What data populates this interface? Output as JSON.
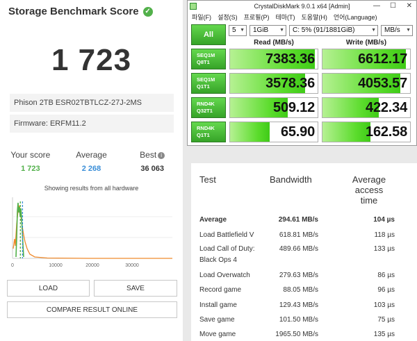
{
  "score_panel": {
    "title": "Storage Benchmark Score",
    "score": "1 723",
    "drive": "Phison 2TB ESR02TBTLCZ-27J-2MS",
    "firmware": "Firmware: ERFM11.2",
    "stats": [
      {
        "label": "Your score",
        "value": "1 723",
        "color": "#52b04a"
      },
      {
        "label": "Average",
        "value": "2 268",
        "color": "#3a8ed8"
      },
      {
        "label": "Best",
        "value": "36 063",
        "color": "#333333"
      }
    ],
    "showing": "Showing results from all hardware",
    "histogram": {
      "x_ticks": [
        "0",
        "10000",
        "20000",
        "30000"
      ],
      "your_score": 1723,
      "average": 2268,
      "peak_color": "#52b04a",
      "tail_color": "#ef8a2c"
    },
    "load_label": "LOAD",
    "save_label": "SAVE",
    "compare_label": "COMPARE RESULT ONLINE"
  },
  "cdm": {
    "title": "CrystalDiskMark 9.0.1 x64 [Admin]",
    "menu": [
      "파일(F)",
      "설정(S)",
      "프로필(P)",
      "테마(T)",
      "도움말(H)",
      "언어(Language)"
    ],
    "all_label": "All",
    "count": "5",
    "size": "1GiB",
    "drive": "C: 5% (91/1881GiB)",
    "unit": "MB/s",
    "read_header": "Read (MB/s)",
    "write_header": "Write (MB/s)",
    "rows": [
      {
        "line1": "SEQ1M",
        "line2": "Q8T1",
        "read": "7383.36",
        "write": "6612.17",
        "read_pct": 0.97,
        "write_pct": 0.95
      },
      {
        "line1": "SEQ1M",
        "line2": "Q1T1",
        "read": "3578.36",
        "write": "4053.57",
        "read_pct": 0.86,
        "write_pct": 0.89
      },
      {
        "line1": "RND4K",
        "line2": "Q32T1",
        "read": "509.12",
        "write": "422.34",
        "read_pct": 0.66,
        "write_pct": 0.64
      },
      {
        "line1": "RND4K",
        "line2": "Q1T1",
        "read": "65.90",
        "write": "162.58",
        "read_pct": 0.45,
        "write_pct": 0.55
      }
    ]
  },
  "results_table": {
    "headers": {
      "test": "Test",
      "bandwidth": "Bandwidth",
      "access_1": "Average",
      "access_2": "access",
      "access_3": "time"
    },
    "rows": [
      {
        "test": "Average",
        "bandwidth": "294.61 MB/s",
        "access": "104 µs",
        "bold": true
      },
      {
        "test": "Load Battlefield V",
        "bandwidth": "618.81 MB/s",
        "access": "118 µs"
      },
      {
        "test": "Load Call of Duty:",
        "test2": "Black Ops 4",
        "bandwidth": "489.66 MB/s",
        "access": "133 µs"
      },
      {
        "test": "Load Overwatch",
        "bandwidth": "279.63 MB/s",
        "access": "86 µs"
      },
      {
        "test": "Record game",
        "bandwidth": "88.05 MB/s",
        "access": "96 µs"
      },
      {
        "test": "Install game",
        "bandwidth": "129.43 MB/s",
        "access": "103 µs"
      },
      {
        "test": "Save game",
        "bandwidth": "101.50 MB/s",
        "access": "75 µs"
      },
      {
        "test": "Move game",
        "bandwidth": "1965.50 MB/s",
        "access": "135 µs"
      }
    ]
  }
}
